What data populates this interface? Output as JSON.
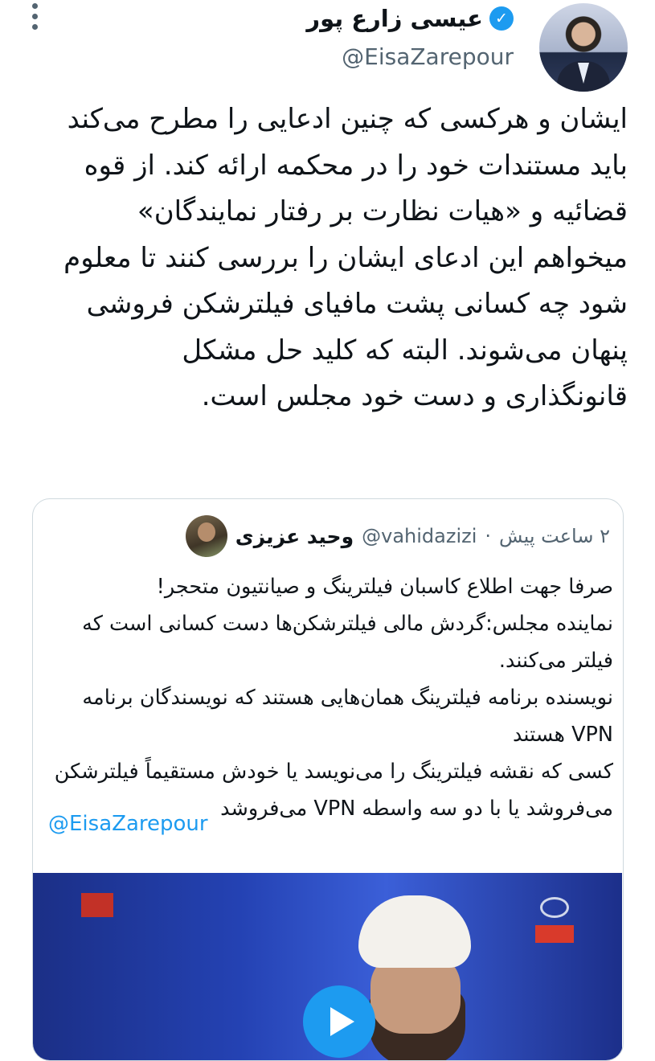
{
  "author": {
    "name": "عیسی زارع پور",
    "handle": "@EisaZarepour",
    "verified_icon": "verified-badge-icon"
  },
  "tweet": {
    "text": "ایشان و هرکسی که چنین ادعایی را مطرح می‌کند باید مستندات خود را در محکمه ارائه کند. از قوه قضائیه و «هیات نظارت بر رفتار نمایندگان» میخواهم این ادعای ایشان را بررسی کنند تا معلوم شود چه کسانی پشت مافیای فیلترشکن فروشی پنهان می‌شوند. البته که کلید حل مشکل قانونگذاری و دست خود مجلس است."
  },
  "quoted_tweet": {
    "name": "وحید عزیزی",
    "handle": "@vahidazizi",
    "time": "۲ ساعت پیش",
    "separator": "·",
    "lines": [
      "صرفا جهت اطلاع کاسبان فیلترینگ و صیانتیون متحجر!",
      "نماینده مجلس:گردش مالی فیلترشکن‌ها دست کسانی است که فیلتر می‌کنند.",
      "نویسنده برنامه فیلترینگ همان‌هایی هستند که نویسندگان برنامه VPN هستند",
      "کسی که نقشه فیلترینگ را می‌نویسد یا خودش مستقیماً فیلترشکن می‌فروشد یا با دو سه واسطه VPN می‌فروشد"
    ],
    "mention": "@EisaZarepour"
  },
  "colors": {
    "accent": "#1d9bf0",
    "muted": "#536471",
    "border": "#cfd9de"
  }
}
